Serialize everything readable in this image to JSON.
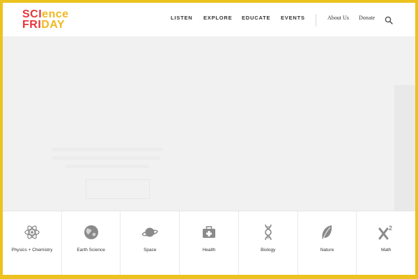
{
  "logo": {
    "line1_a": "SCI",
    "line1_b": "ence",
    "line2_a": "FRI",
    "line2_b": "DAY"
  },
  "nav": {
    "listen": "LISTEN",
    "explore": "EXPLORE",
    "educate": "EDUCATE",
    "events": "EVENTS",
    "about": "About Us",
    "donate": "Donate"
  },
  "topics": [
    {
      "label": "Physics + Chemistry",
      "icon": "atom-icon"
    },
    {
      "label": "Earth Science",
      "icon": "globe-icon"
    },
    {
      "label": "Space",
      "icon": "planet-icon"
    },
    {
      "label": "Health",
      "icon": "medical-kit-icon"
    },
    {
      "label": "Biology",
      "icon": "dna-icon"
    },
    {
      "label": "Nature",
      "icon": "leaf-icon"
    },
    {
      "label": "Math",
      "icon": "x-squared-icon"
    }
  ],
  "colors": {
    "accent": "#ecc21f",
    "logo_red": "#e8353b",
    "logo_yellow": "#f0b81f",
    "hero_bg": "#f1f1f1"
  }
}
